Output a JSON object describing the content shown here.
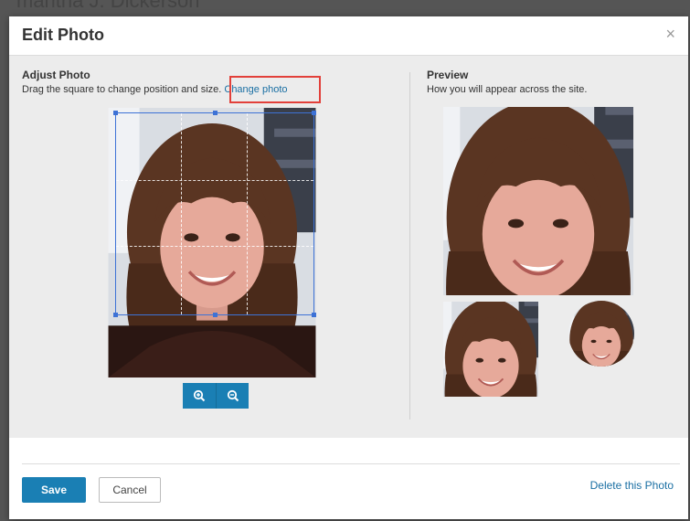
{
  "background": {
    "partial_name": "mantha J. Dickerson"
  },
  "dialog": {
    "title": "Edit Photo",
    "close_glyph": "×"
  },
  "adjust": {
    "heading": "Adjust Photo",
    "description": "Drag the square to change position and size.",
    "change_photo_link": "Change photo"
  },
  "preview": {
    "heading": "Preview",
    "description": "How you will appear across the site."
  },
  "zoom": {
    "zoom_in_icon": "zoom-in-icon",
    "zoom_out_icon": "zoom-out-icon"
  },
  "footer": {
    "save_label": "Save",
    "cancel_label": "Cancel",
    "delete_label": "Delete this Photo"
  },
  "colors": {
    "accent": "#1a7fb4",
    "link": "#1a6fa3",
    "highlight": "#e2403a",
    "crop_border": "#3d72d6",
    "panel_bg": "#ececec"
  }
}
